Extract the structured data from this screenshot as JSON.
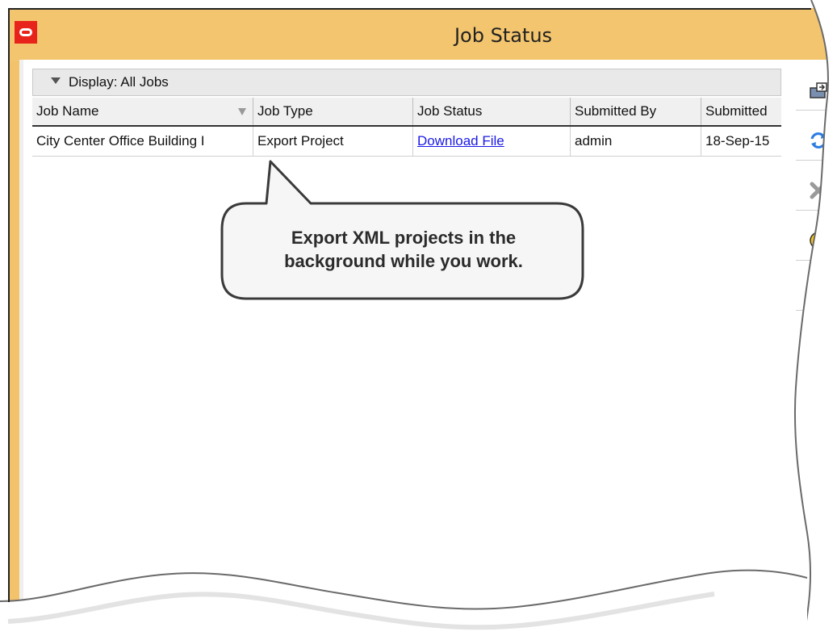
{
  "window": {
    "title": "Job Status"
  },
  "display_filter": {
    "label": "Display: All Jobs"
  },
  "table": {
    "columns": [
      "Job Name",
      "Job Type",
      "Job Status",
      "Submitted By",
      "Submitted"
    ],
    "rows": [
      {
        "job_name": "City Center Office Building I",
        "job_type": "Export Project",
        "job_status": "Download File",
        "submitted_by": "admin",
        "submitted": "18-Sep-15"
      }
    ]
  },
  "toolbar": {
    "icons": [
      "export-icon",
      "refresh-icon",
      "delete-icon",
      "help-icon"
    ]
  },
  "callout": {
    "line1": "Export XML projects in the",
    "line2": "background while you work."
  },
  "colors": {
    "title_bar": "#f3c56e",
    "app_icon": "#e8231b",
    "link": "#1a18e6"
  }
}
